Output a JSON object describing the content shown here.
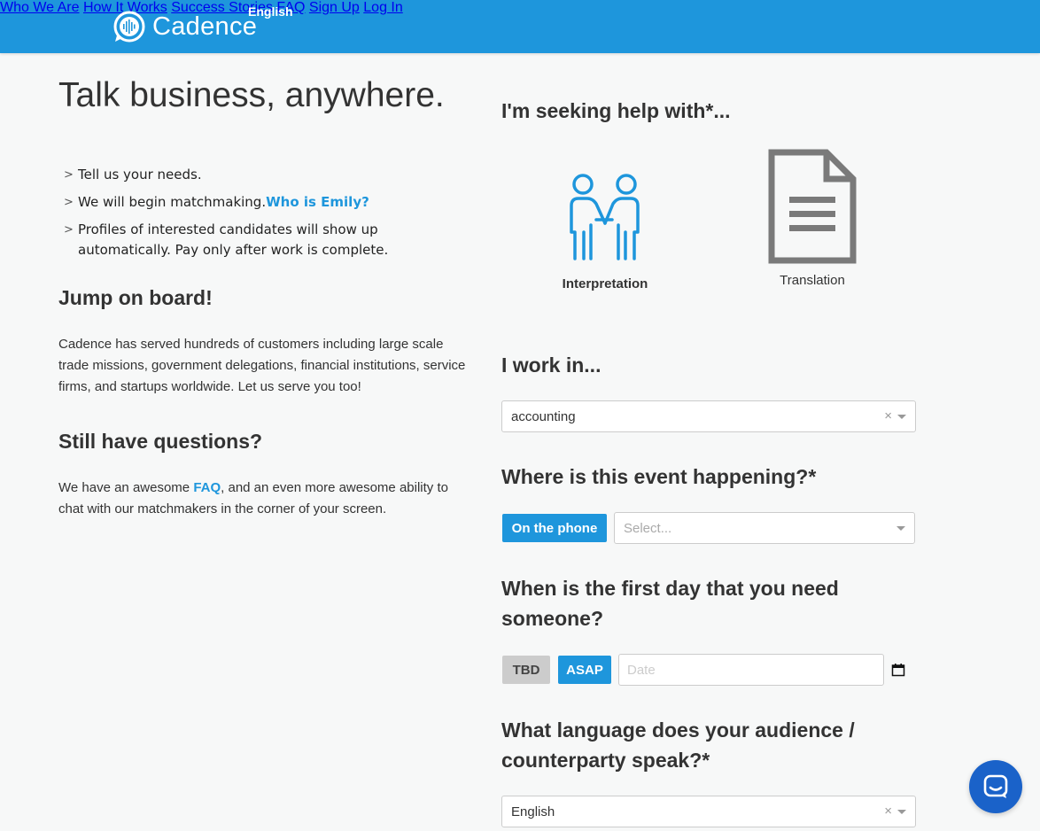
{
  "header": {
    "brand": "Cadence",
    "language": "English",
    "nav": [
      "Who We Are",
      "How It Works",
      "Success Stories",
      "FAQ",
      "Sign Up",
      "Log In"
    ]
  },
  "left": {
    "title": "Talk business, anywhere.",
    "steps": [
      {
        "text": "Tell us your needs.",
        "link": ""
      },
      {
        "text": "We will begin matchmaking.",
        "link": "Who is Emily?"
      },
      {
        "text": "Profiles of interested candidates will show up automatically. Pay only after work is complete.",
        "link": ""
      }
    ],
    "board_heading": "Jump on board!",
    "board_text": "Cadence has served hundreds of customers including large scale trade missions, government delegations, financial institutions, service firms, and startups worldwide. Let us serve you too!",
    "questions_heading": "Still have questions?",
    "questions_pre": "We have an awesome ",
    "questions_link": "FAQ",
    "questions_post": ", and an even more awesome ability to chat with our matchmakers in the corner of your screen."
  },
  "form": {
    "seeking_heading": "I'm seeking help with*...",
    "services": [
      {
        "label": "Interpretation",
        "icon": "handshake-icon"
      },
      {
        "label": "Translation",
        "icon": "document-icon"
      }
    ],
    "industry_heading": "I work in...",
    "industry_value": "accounting",
    "location_heading": "Where is this event happening?*",
    "location_phone_button": "On the phone",
    "location_placeholder": "Select...",
    "date_heading": "When is the first day that you need someone?",
    "date_tbd": "TBD",
    "date_asap": "ASAP",
    "date_placeholder": "Date",
    "language_heading": "What language does your audience / counterparty speak?*",
    "language_value": "English",
    "clear_symbol": "×"
  },
  "colors": {
    "brand": "#1e96dc",
    "chat": "#1a62c9",
    "icon_gray": "#7a7a7a"
  }
}
